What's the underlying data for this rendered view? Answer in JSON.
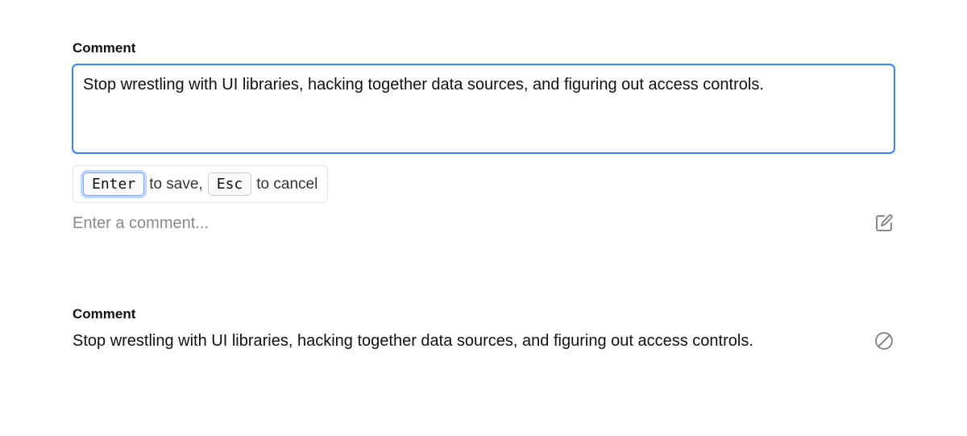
{
  "fields": {
    "editable": {
      "label": "Comment",
      "value": "Stop wrestling with UI libraries, hacking together data sources, and figuring out access controls.",
      "placeholder_below": "Enter a comment...",
      "hints": {
        "key_save": "Enter",
        "text_save": "to save,",
        "key_cancel": "Esc",
        "text_cancel": "to cancel"
      }
    },
    "readonly": {
      "label": "Comment",
      "value": "Stop wrestling with UI libraries, hacking together data sources, and figuring out access controls."
    }
  },
  "icons": {
    "edit": "edit-icon",
    "blocked": "blocked-icon"
  }
}
